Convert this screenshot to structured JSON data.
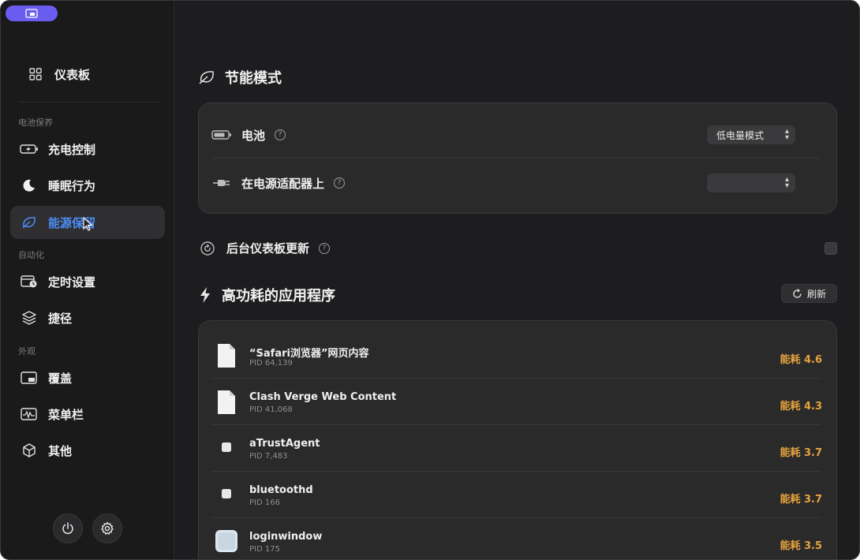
{
  "sidebar": {
    "dashboard": {
      "label": "仪表板",
      "icon": "grid-icon"
    },
    "sections": [
      {
        "label": "电池保养"
      },
      {
        "label": "自动化"
      },
      {
        "label": "外观"
      }
    ],
    "items": [
      {
        "label": "充电控制",
        "icon": "battery-charging-icon"
      },
      {
        "label": "睡眠行为",
        "icon": "moon-icon"
      },
      {
        "label": "能源保留",
        "icon": "leaf-icon",
        "active": true
      },
      {
        "label": "定时设置",
        "icon": "calendar-clock-icon"
      },
      {
        "label": "捷径",
        "icon": "layers-icon"
      },
      {
        "label": "覆盖",
        "icon": "overlay-icon"
      },
      {
        "label": "菜单栏",
        "icon": "waveform-icon"
      },
      {
        "label": "其他",
        "icon": "cube-icon"
      }
    ],
    "footer": {
      "power_icon": "power-icon",
      "settings_icon": "gear-icon"
    }
  },
  "energy_mode": {
    "title": "节能模式",
    "battery": {
      "label": "电池",
      "help": "?",
      "value": "低电量模式"
    },
    "adapter": {
      "label": "在电源适配器上",
      "help": "?",
      "value": ""
    }
  },
  "background_update": {
    "label": "后台仪表板更新",
    "help": "?",
    "checked": false
  },
  "high_energy": {
    "title": "高功耗的应用程序",
    "refresh_label": "刷新",
    "apps": [
      {
        "name": "“Safari浏览器”网页内容",
        "pid": "PID 64,139",
        "energy": "能耗 4.6",
        "icon": "document-icon"
      },
      {
        "name": "Clash Verge Web Content",
        "pid": "PID 41,068",
        "energy": "能耗 4.3",
        "icon": "document-icon"
      },
      {
        "name": "aTrustAgent",
        "pid": "PID 7,483",
        "energy": "能耗 3.7",
        "icon": "executable-icon"
      },
      {
        "name": "bluetoothd",
        "pid": "PID 166",
        "energy": "能耗 3.7",
        "icon": "executable-icon"
      },
      {
        "name": "loginwindow",
        "pid": "PID 175",
        "energy": "能耗 3.5",
        "icon": "app-icon"
      }
    ]
  },
  "colors": {
    "accent": "#4d8df7",
    "energy": "#e8a33d",
    "pill": "#6b5cf0"
  }
}
